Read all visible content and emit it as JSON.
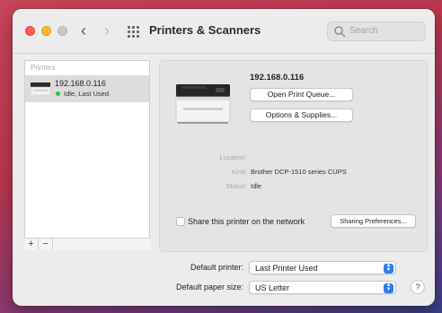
{
  "window": {
    "title": "Printers & Scanners",
    "search_placeholder": "Search"
  },
  "nav": {
    "back_glyph": "‹",
    "forward_glyph": "›"
  },
  "sidebar": {
    "header": "Printers",
    "printers": [
      {
        "name": "192.168.0.116",
        "status": "Idle, Last Used",
        "status_color": "#2ec243",
        "selected": true
      }
    ],
    "add_label": "+",
    "remove_label": "−"
  },
  "detail": {
    "printer_name": "192.168.0.116",
    "open_queue_label": "Open Print Queue...",
    "options_supplies_label": "Options & Supplies...",
    "info": [
      {
        "label": "Location:",
        "value": ""
      },
      {
        "label": "Kind:",
        "value": "Brother DCP-1510 series CUPS"
      },
      {
        "label": "Status:",
        "value": "Idle"
      }
    ],
    "share_label": "Share this printer on the network",
    "share_checked": false,
    "sharing_prefs_label": "Sharing Preferences..."
  },
  "defaults": {
    "printer_label": "Default printer:",
    "printer_value": "Last Printer Used",
    "paper_label": "Default paper size:",
    "paper_value": "US Letter"
  },
  "help_label": "?",
  "colors": {
    "accent": "#2f7cf6",
    "status_idle": "#2ec243"
  }
}
